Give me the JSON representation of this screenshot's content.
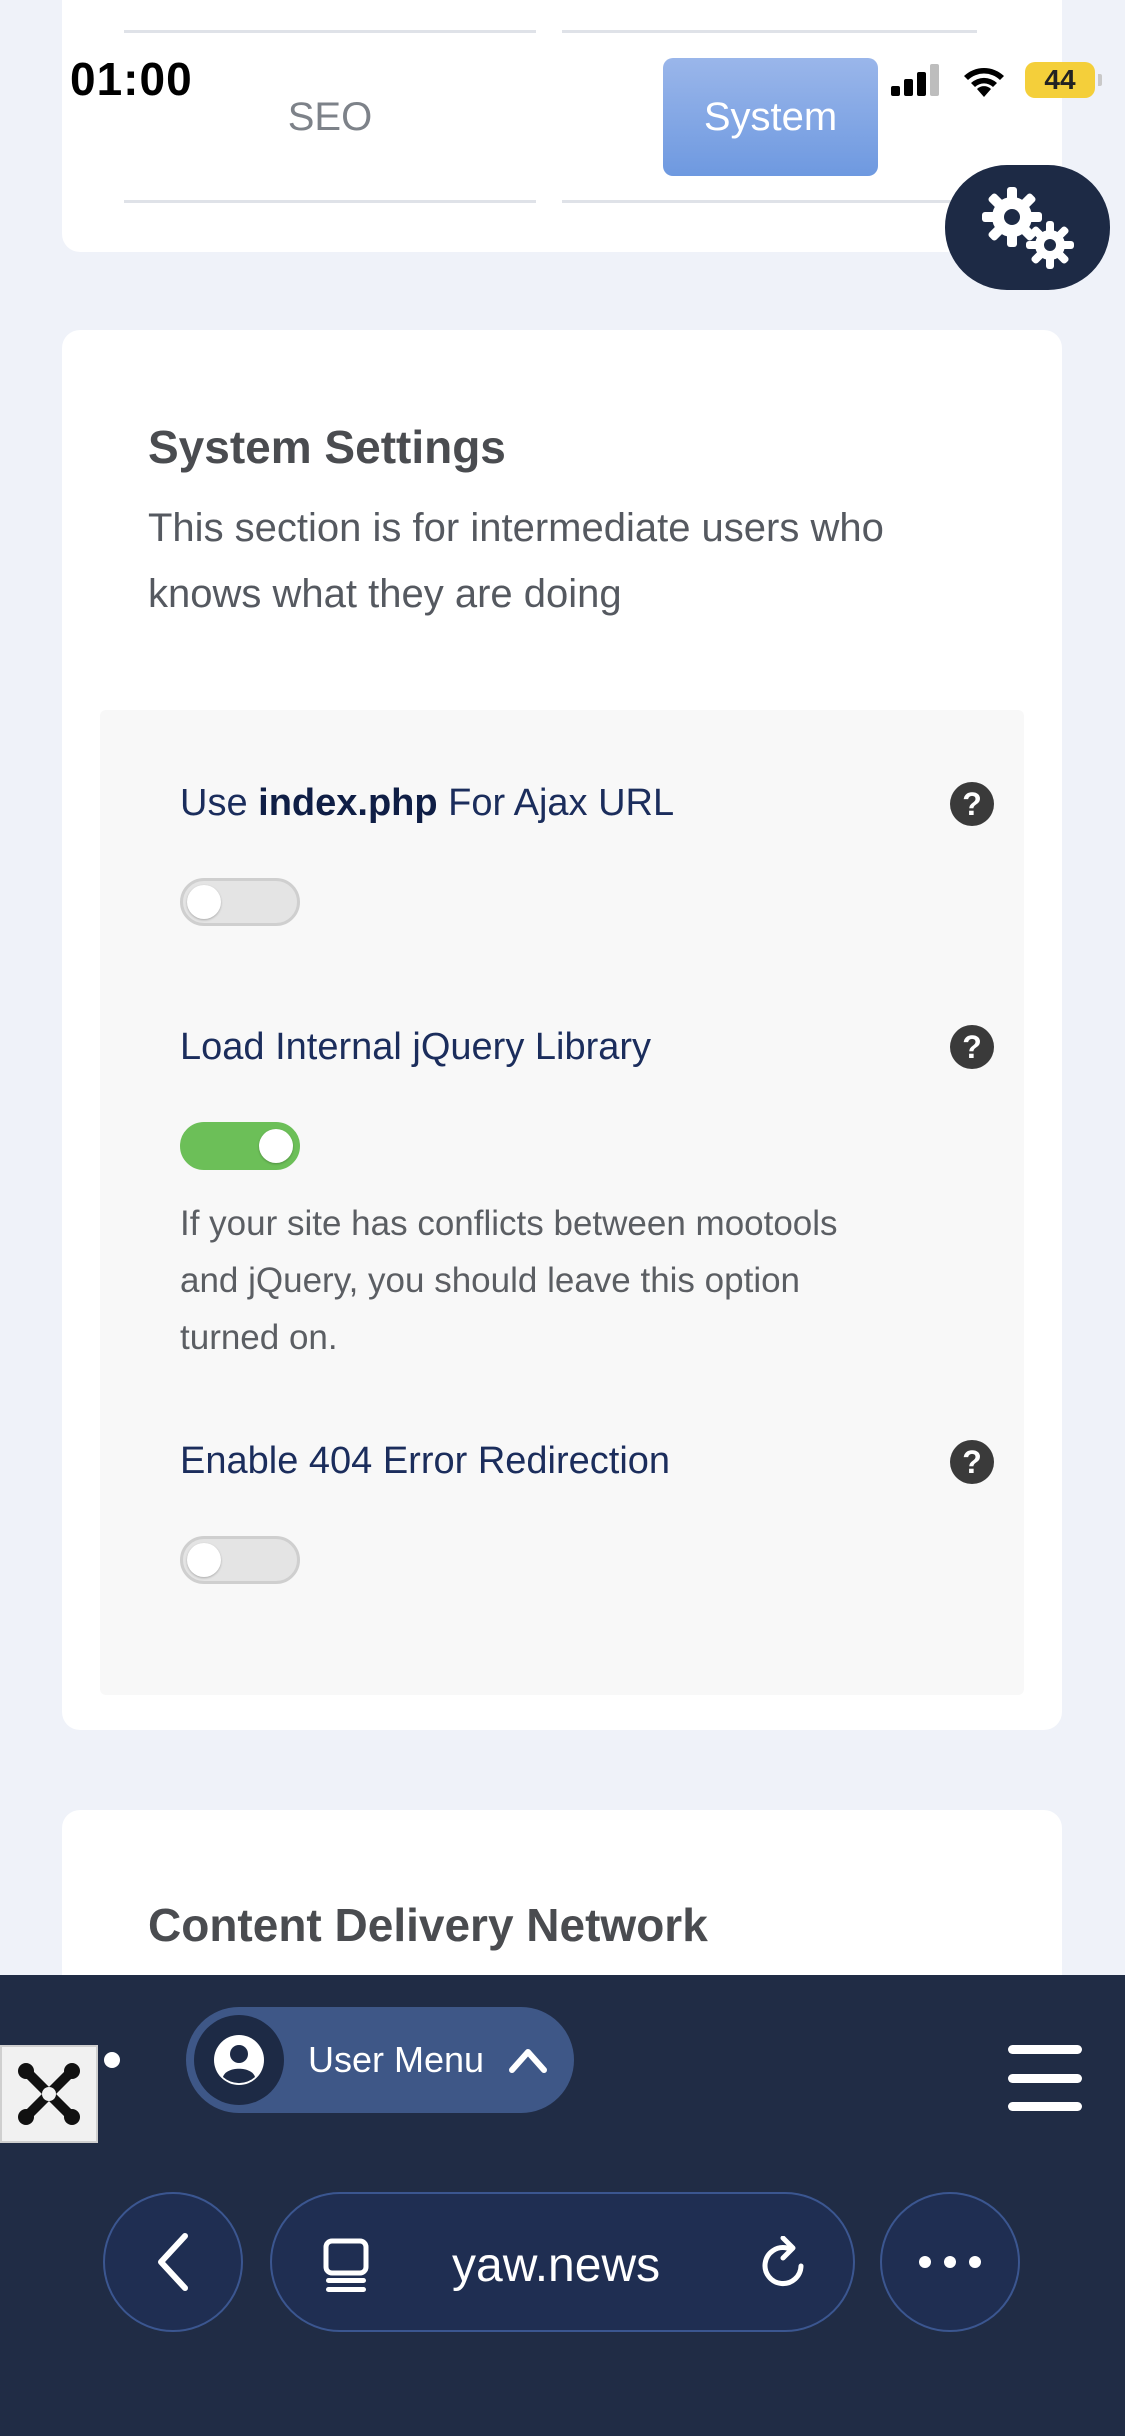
{
  "status_bar": {
    "time": "01:00",
    "battery": "44"
  },
  "tabs": {
    "seo": "SEO",
    "system": "System"
  },
  "system_settings": {
    "title": "System Settings",
    "description": "This section is for intermediate users who knows what they are doing",
    "options": [
      {
        "prefix": "Use ",
        "bold": "index.php",
        "suffix": " For Ajax URL",
        "enabled": false
      },
      {
        "label": "Load Internal jQuery Library",
        "enabled": true,
        "note": "If your site has conflicts between mootools and jQuery, you should leave this option turned on."
      },
      {
        "label": "Enable 404 Error Redirection",
        "enabled": false
      }
    ],
    "help_glyph": "?"
  },
  "cdn": {
    "title": "Content Delivery Network"
  },
  "admin_bar": {
    "user_menu": "User Menu"
  },
  "browser": {
    "url": "yaw.news"
  },
  "colors": {
    "toggle_on": "#6cbf58",
    "admin_bar": "#202c45",
    "tab_active": "#6e99e0"
  }
}
